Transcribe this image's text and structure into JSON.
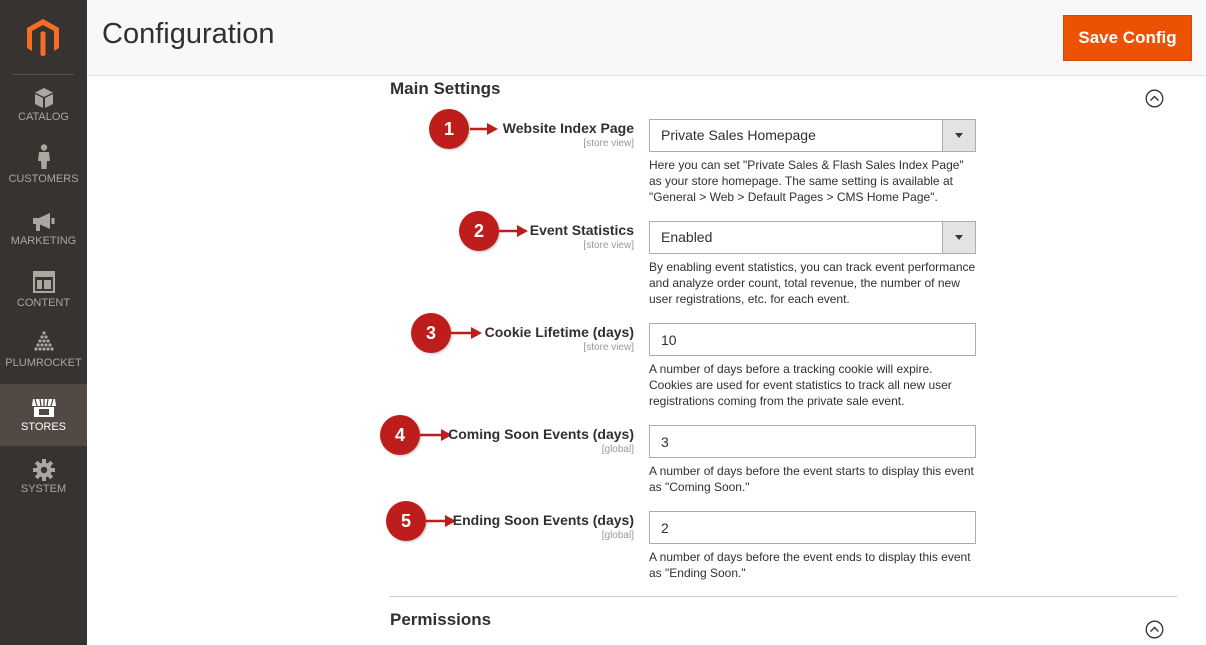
{
  "sidebar": {
    "logo": "magento-logo",
    "items": [
      {
        "label": "CATALOG",
        "icon": "cube-icon"
      },
      {
        "label": "CUSTOMERS",
        "icon": "person-icon"
      },
      {
        "label": "MARKETING",
        "icon": "megaphone-icon"
      },
      {
        "label": "CONTENT",
        "icon": "layout-icon"
      },
      {
        "label": "PLUMROCKET",
        "icon": "pyramid-icon"
      },
      {
        "label": "STORES",
        "icon": "storefront-icon",
        "active": true
      },
      {
        "label": "SYSTEM",
        "icon": "gear-icon"
      }
    ]
  },
  "header": {
    "title": "Configuration",
    "save_label": "Save Config"
  },
  "main_settings": {
    "title": "Main Settings",
    "fields": [
      {
        "badge": "1",
        "label": "Website Index Page",
        "scope": "[store view]",
        "type": "select",
        "value": "Private Sales Homepage",
        "note": "Here you can set \"Private Sales & Flash Sales Index Page\" as your store homepage. The same setting is available at \"General > Web > Default Pages > CMS Home Page\"."
      },
      {
        "badge": "2",
        "label": "Event Statistics",
        "scope": "[store view]",
        "type": "select",
        "value": "Enabled",
        "note": "By enabling event statistics, you can track event performance and analyze order count, total revenue, the number of new user registrations, etc. for each event."
      },
      {
        "badge": "3",
        "label": "Cookie Lifetime (days)",
        "scope": "[store view]",
        "type": "input",
        "value": "10",
        "note": "A number of days before a tracking cookie will expire. Cookies are used for event statistics to track all new user registrations coming from the private sale event."
      },
      {
        "badge": "4",
        "label": "Coming Soon Events (days)",
        "scope": "[global]",
        "type": "input",
        "value": "3",
        "note": "A number of days before the event starts to display this event as \"Coming Soon.\""
      },
      {
        "badge": "5",
        "label": "Ending Soon Events (days)",
        "scope": "[global]",
        "type": "input",
        "value": "2",
        "note": "A number of days before the event ends to display this event as \"Ending Soon.\""
      }
    ]
  },
  "permissions": {
    "title": "Permissions"
  },
  "colors": {
    "accent": "#eb5202",
    "badge": "#be1e1b",
    "sidebar": "#373330",
    "sidebar_active": "#514943"
  }
}
